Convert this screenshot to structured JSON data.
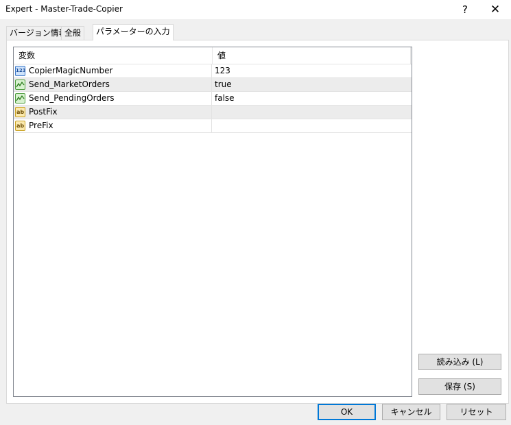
{
  "window": {
    "title": "Expert - Master-Trade-Copier",
    "help_label": "?",
    "close_label": "✕"
  },
  "tabs": [
    {
      "label": "バージョン情報",
      "active": false
    },
    {
      "label": "全般",
      "active": false
    },
    {
      "label": "パラメーターの入力",
      "active": true
    }
  ],
  "grid": {
    "columns": {
      "variable": "変数",
      "value": "値"
    },
    "rows": [
      {
        "icon": "integer-type-icon",
        "icon_text": "123",
        "name": "CopierMagicNumber",
        "value": "123"
      },
      {
        "icon": "boolean-type-icon",
        "icon_text": "",
        "name": "Send_MarketOrders",
        "value": "true"
      },
      {
        "icon": "boolean-type-icon",
        "icon_text": "",
        "name": "Send_PendingOrders",
        "value": "false"
      },
      {
        "icon": "string-type-icon",
        "icon_text": "ab",
        "name": "PostFix",
        "value": ""
      },
      {
        "icon": "string-type-icon",
        "icon_text": "ab",
        "name": "PreFix",
        "value": ""
      }
    ]
  },
  "buttons": {
    "load": "読み込み (L)",
    "save": "保存 (S)",
    "ok": "OK",
    "cancel": "キャンセル",
    "reset": "リセット"
  }
}
